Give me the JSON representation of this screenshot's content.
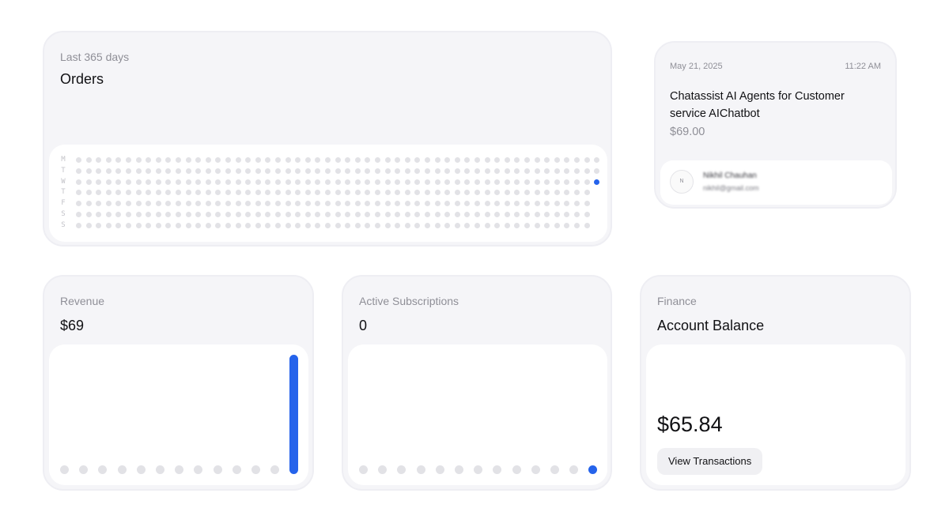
{
  "orders": {
    "period_label": "Last 365 days",
    "title": "Orders",
    "day_labels": [
      "M",
      "T",
      "W",
      "T",
      "F",
      "S",
      "S"
    ],
    "weeks_shown": 53,
    "active_cell": {
      "week_index": 52,
      "day_index": 2
    }
  },
  "transaction": {
    "date": "May 21, 2025",
    "time": "11:22 AM",
    "product": "Chatassist AI Agents for Customer service AIChatbot",
    "price": "$69.00",
    "customer": {
      "avatar_initials": "N",
      "name": "Nikhil Chauhan",
      "email": "nikhil@gmail.com"
    }
  },
  "revenue": {
    "label": "Revenue",
    "value": "$69",
    "chart_data": {
      "type": "bar",
      "values": [
        0,
        0,
        0,
        0,
        0,
        0,
        0,
        0,
        0,
        0,
        0,
        0,
        69
      ]
    }
  },
  "subscriptions": {
    "label": "Active Subscriptions",
    "value": "0",
    "chart_data": {
      "type": "bar",
      "values": [
        0,
        0,
        0,
        0,
        0,
        0,
        0,
        0,
        0,
        0,
        0,
        0,
        0
      ],
      "highlight_index": 12
    }
  },
  "finance": {
    "label": "Finance",
    "title": "Account Balance",
    "balance": "$65.84",
    "button_label": "View Transactions"
  },
  "colors": {
    "accent": "#2563eb",
    "card_bg": "#f5f5f8",
    "dot_inactive": "#e2e2e6",
    "muted_text": "#8f8f97"
  }
}
